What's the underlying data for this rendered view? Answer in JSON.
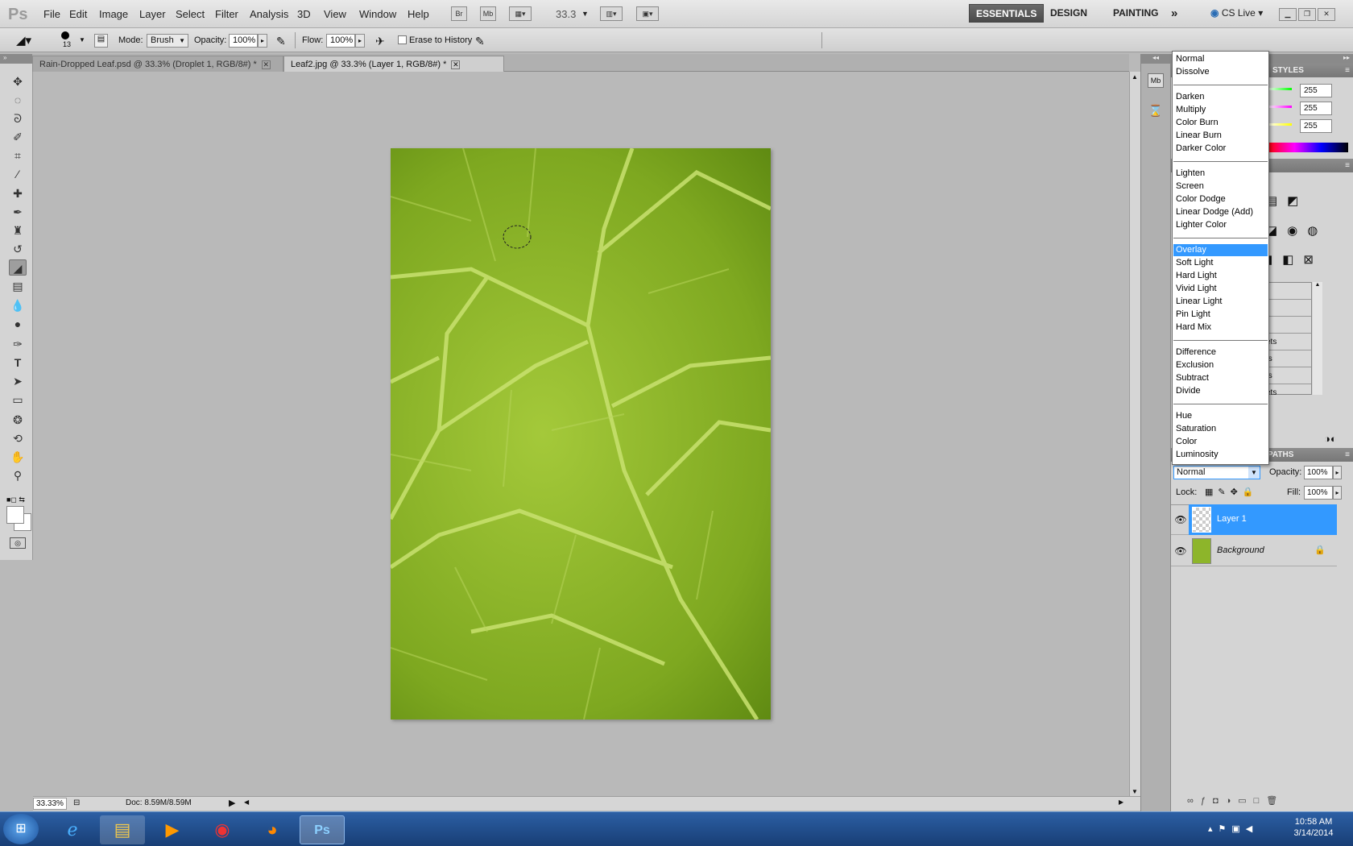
{
  "app": {
    "logo": "Ps"
  },
  "menu": [
    "File",
    "Edit",
    "Image",
    "Layer",
    "Select",
    "Filter",
    "Analysis",
    "3D",
    "View",
    "Window",
    "Help"
  ],
  "appbar": {
    "bridge_label": "Br",
    "minibridge_label": "Mb",
    "zoom": "33.3"
  },
  "workspaces": {
    "essentials": "ESSENTIALS",
    "design": "DESIGN",
    "painting": "PAINTING",
    "more": "»",
    "cslive": "CS Live"
  },
  "options": {
    "brush_size": "13",
    "mode_label": "Mode:",
    "mode_value": "Brush",
    "opacity_label": "Opacity:",
    "opacity_value": "100%",
    "flow_label": "Flow:",
    "flow_value": "100%",
    "erase_history_label": "Erase to History"
  },
  "tabs": [
    {
      "label": "Rain-Dropped Leaf.psd @ 33.3% (Droplet 1, RGB/8#) *",
      "active": false
    },
    {
      "label": "Leaf2.jpg @ 33.3% (Layer 1, RGB/8#) *",
      "active": true
    }
  ],
  "status": {
    "zoom": "33.33%",
    "doc": "Doc: 8.59M/8.59M"
  },
  "right_panel": {
    "styles_header": "STYLES",
    "color_values": [
      "255",
      "255",
      "255"
    ],
    "paths_header": "PATHS",
    "list_fragments": [
      "ets",
      "ts",
      "ts",
      "ets"
    ]
  },
  "layers": {
    "blend_mode": "Normal",
    "opacity_label": "Opacity:",
    "opacity_value": "100%",
    "lock_label": "Lock:",
    "fill_label": "Fill:",
    "fill_value": "100%",
    "items": [
      {
        "name": "Layer 1",
        "selected": true
      },
      {
        "name": "Background",
        "selected": false
      }
    ]
  },
  "blend_menu": {
    "groups": [
      [
        "Normal",
        "Dissolve"
      ],
      [
        "Darken",
        "Multiply",
        "Color Burn",
        "Linear Burn",
        "Darker Color"
      ],
      [
        "Lighten",
        "Screen",
        "Color Dodge",
        "Linear Dodge (Add)",
        "Lighter Color"
      ],
      [
        "Overlay",
        "Soft Light",
        "Hard Light",
        "Vivid Light",
        "Linear Light",
        "Pin Light",
        "Hard Mix"
      ],
      [
        "Difference",
        "Exclusion",
        "Subtract",
        "Divide"
      ],
      [
        "Hue",
        "Saturation",
        "Color",
        "Luminosity"
      ]
    ],
    "selected": "Overlay"
  },
  "taskbar": {
    "time": "10:58 AM",
    "date": "3/14/2014"
  },
  "colors": {
    "accent": "#3399ff",
    "leaf": "#8db52a",
    "taskbar": "#1f4a8a"
  }
}
